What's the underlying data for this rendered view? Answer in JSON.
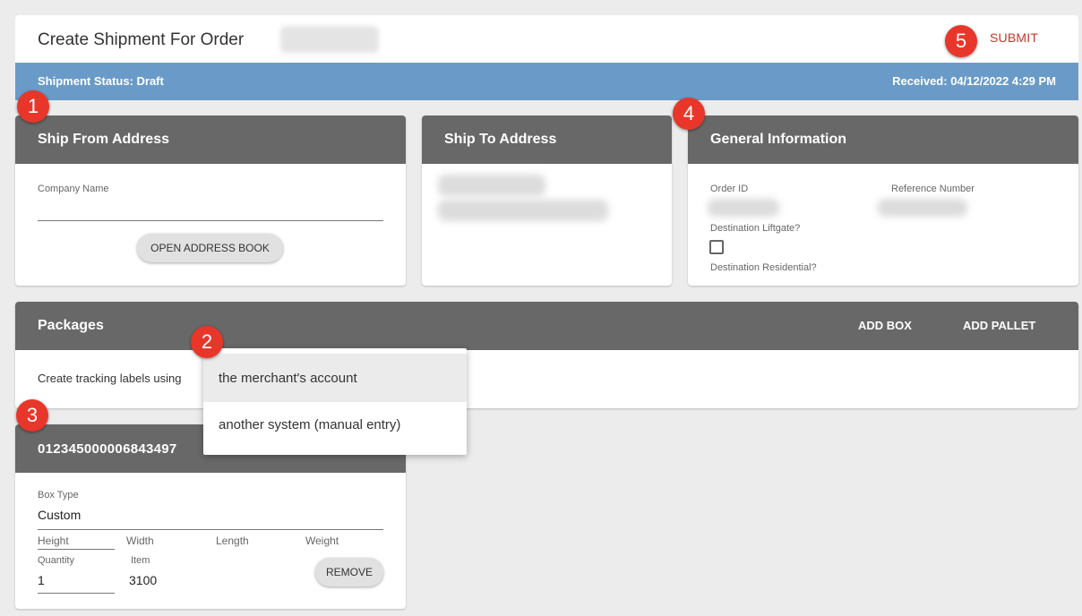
{
  "header": {
    "title": "Create Shipment For Order",
    "submit_label": "SUBMIT"
  },
  "status": {
    "shipment_status": "Shipment Status: Draft",
    "received": "Received: 04/12/2022 4:29 PM",
    "bar_color": "#6a9bc8"
  },
  "ship_from": {
    "title": "Ship From Address",
    "company_label": "Company Name",
    "address_book_label": "OPEN ADDRESS BOOK"
  },
  "ship_to": {
    "title": "Ship To Address"
  },
  "general": {
    "title": "General Information",
    "order_id_label": "Order ID",
    "reference_label": "Reference Number",
    "liftgate_label": "Destination Liftgate?",
    "residential_label": "Destination Residential?"
  },
  "packages": {
    "title": "Packages",
    "add_box_label": "ADD BOX",
    "add_pallet_label": "ADD PALLET",
    "tracking_label": "Create tracking labels using",
    "dropdown_options": [
      "the merchant's account",
      "another system (manual entry)"
    ]
  },
  "box": {
    "tracking_number": "012345000006843497",
    "box_type_label": "Box Type",
    "box_type_value": "Custom",
    "height_label": "Height",
    "width_label": "Width",
    "length_label": "Length",
    "weight_label": "Weight",
    "quantity_label": "Quantity",
    "quantity_value": "1",
    "item_label": "Item",
    "item_value": "3100",
    "remove_label": "REMOVE"
  },
  "badges": [
    "1",
    "2",
    "3",
    "4",
    "5"
  ],
  "colors": {
    "accent_red": "#e8372a",
    "submit_red": "#c0392b",
    "card_header": "#686868"
  }
}
